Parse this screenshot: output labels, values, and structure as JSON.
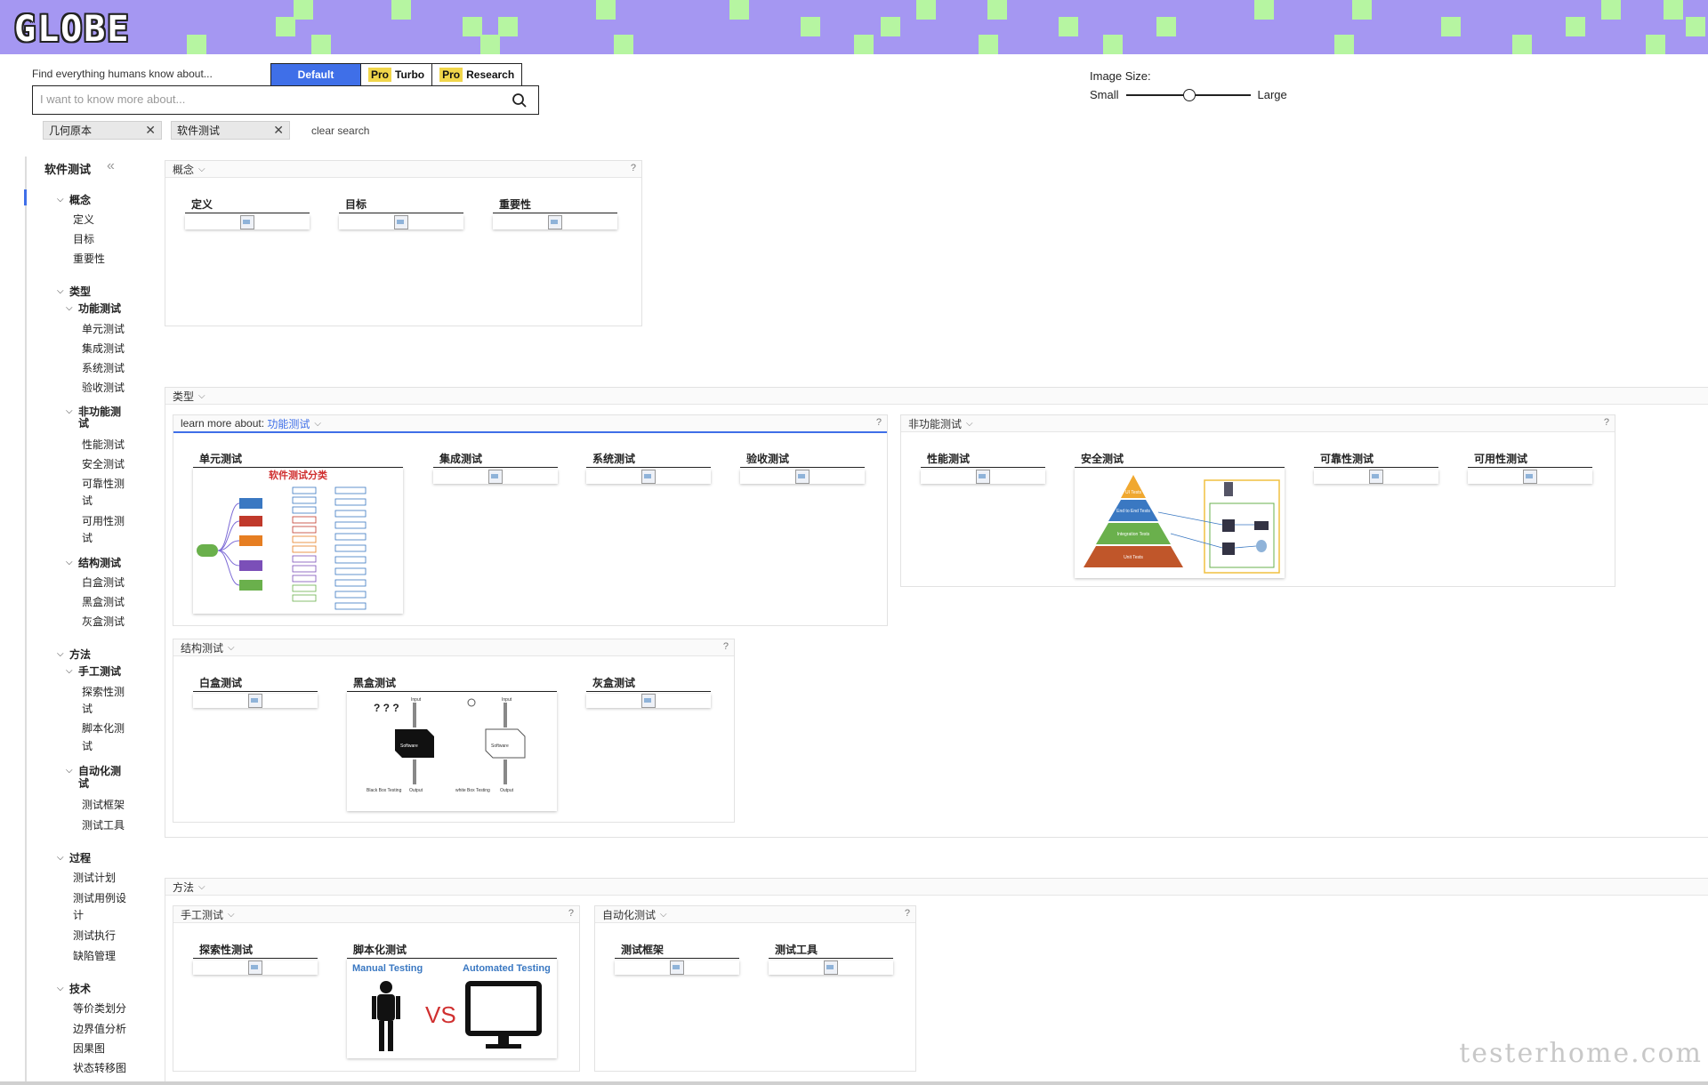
{
  "app": {
    "logo": "GLOBE"
  },
  "search": {
    "hint": "Find everything humans know about...",
    "placeholder": "I want to know more about...",
    "modes": [
      {
        "label": "Default"
      },
      {
        "pro": "Pro",
        "label": "Turbo"
      },
      {
        "pro": "Pro",
        "label": "Research"
      }
    ],
    "chips": [
      "几何原本",
      "软件测试"
    ],
    "clear_label": "clear search"
  },
  "image_size": {
    "label": "Image Size:",
    "min_label": "Small",
    "max_label": "Large",
    "value_fraction": 0.5
  },
  "sidebar": {
    "title": "软件测试",
    "items": [
      "概念",
      "定义",
      "目标",
      "重要性",
      "类型",
      "功能测试",
      "单元测试",
      "集成测试",
      "系统测试",
      "验收测试",
      "非功能测",
      "试",
      "性能测试",
      "安全测试",
      "可靠性测",
      "试",
      "可用性测",
      "试",
      "结构测试",
      "白盒测试",
      "黑盒测试",
      "灰盒测试",
      "方法",
      "手工测试",
      "探索性测",
      "试",
      "脚本化测",
      "试",
      "自动化测",
      "试",
      "测试框架",
      "测试工具",
      "过程",
      "测试计划",
      "测试用例设",
      "计",
      "测试执行",
      "缺陷管理",
      "技术",
      "等价类划分",
      "边界值分析",
      "因果图",
      "状态转移图"
    ]
  },
  "panels": {
    "concept": {
      "title": "概念",
      "q": "?",
      "cards": [
        "定义",
        "目标",
        "重要性"
      ]
    },
    "type": {
      "title": "类型"
    },
    "functional": {
      "prefix": "learn more about: ",
      "title": "功能测试",
      "q": "?",
      "cards": [
        "单元测试",
        "集成测试",
        "系统测试",
        "验收测试"
      ],
      "unit_image": {
        "title": "软件测试分类"
      }
    },
    "nonfunctional": {
      "title": "非功能测试",
      "q": "?",
      "cards": [
        "性能测试",
        "安全测试",
        "可靠性测试",
        "可用性测试"
      ],
      "pyramid": [
        "UI Tests",
        "End to End Tests",
        "Integration Tests",
        "Unit Tests"
      ]
    },
    "structural": {
      "title": "结构测试",
      "q": "?",
      "cards": [
        "白盒测试",
        "黑盒测试",
        "灰盒测试"
      ],
      "bb_image": {
        "input": "Input",
        "output": "Output",
        "software": "Software",
        "black": "Black Box Testing",
        "white": "white Box Testing"
      }
    },
    "method": {
      "title": "方法"
    },
    "manual": {
      "title": "手工测试",
      "q": "?",
      "cards": [
        "探索性测试",
        "脚本化测试"
      ],
      "mva": {
        "left": "Manual Testing",
        "right": "Automated Testing",
        "vs": "VS"
      }
    },
    "automation": {
      "title": "自动化测试",
      "q": "?",
      "cards": [
        "测试框架",
        "测试工具"
      ]
    }
  },
  "watermark": "testerhome.com",
  "colors": {
    "accent": "#3f6fe8",
    "banner": "#a597f2",
    "banner_block": "#b6f5a1",
    "pro": "#f1d64a"
  }
}
